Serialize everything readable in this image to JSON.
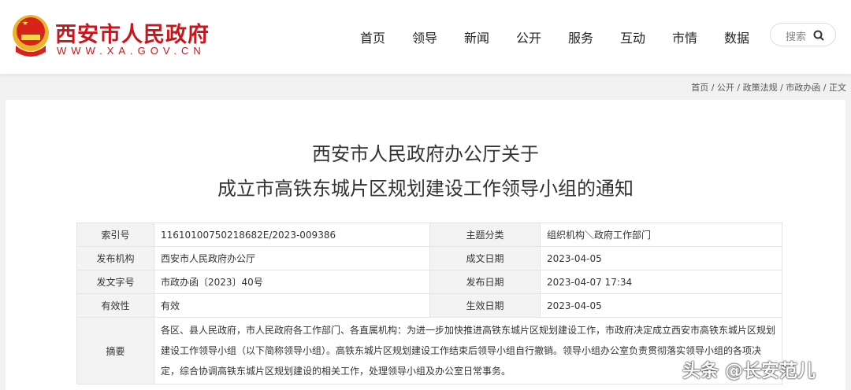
{
  "header": {
    "site_title": "西安市人民政府",
    "site_url": "WWW.XA.GOV.CN",
    "nav": [
      "首页",
      "领导",
      "新闻",
      "公开",
      "服务",
      "互动",
      "市情",
      "数据"
    ],
    "search_label": "搜索"
  },
  "breadcrumb": "首页 / 公开 / 政策法规 / 市政办函 / 正文",
  "article": {
    "title_line1": "西安市人民政府办公厅关于",
    "title_line2": "成立市高铁东城片区规划建设工作领导小组的通知"
  },
  "meta": {
    "index_label": "索引号",
    "index_value": "11610100750218682E/2023-009386",
    "topic_label": "主题分类",
    "topic_value": "组织机构＼政府工作部门",
    "issuer_label": "发布机构",
    "issuer_value": "西安市人民政府办公厅",
    "created_label": "成文日期",
    "created_value": "2023-04-05",
    "docno_label": "发文字号",
    "docno_value": "市政办函〔2023〕40号",
    "published_label": "发布日期",
    "published_value": "2023-04-07 17:34",
    "validity_label": "有效性",
    "validity_value": "有效",
    "effective_label": "生效日期",
    "effective_value": "2023-04-05",
    "summary_label": "摘要",
    "summary_value": "各区、县人民政府，市人民政府各工作部门、各直属机构：为进一步加快推进高铁东城片区规划建设工作，市政府决定成立西安市高铁东城片区规划建设工作领导小组（以下简称领导小组）。高铁东城片区规划建设工作结束后领导小组自行撤销。领导小组办公室负责贯彻落实领导小组的各项决定，综合协调高铁东城片区规划建设的相关工作，处理领导小组及办公室日常事务。"
  },
  "watermark": "头条 @长安范儿"
}
